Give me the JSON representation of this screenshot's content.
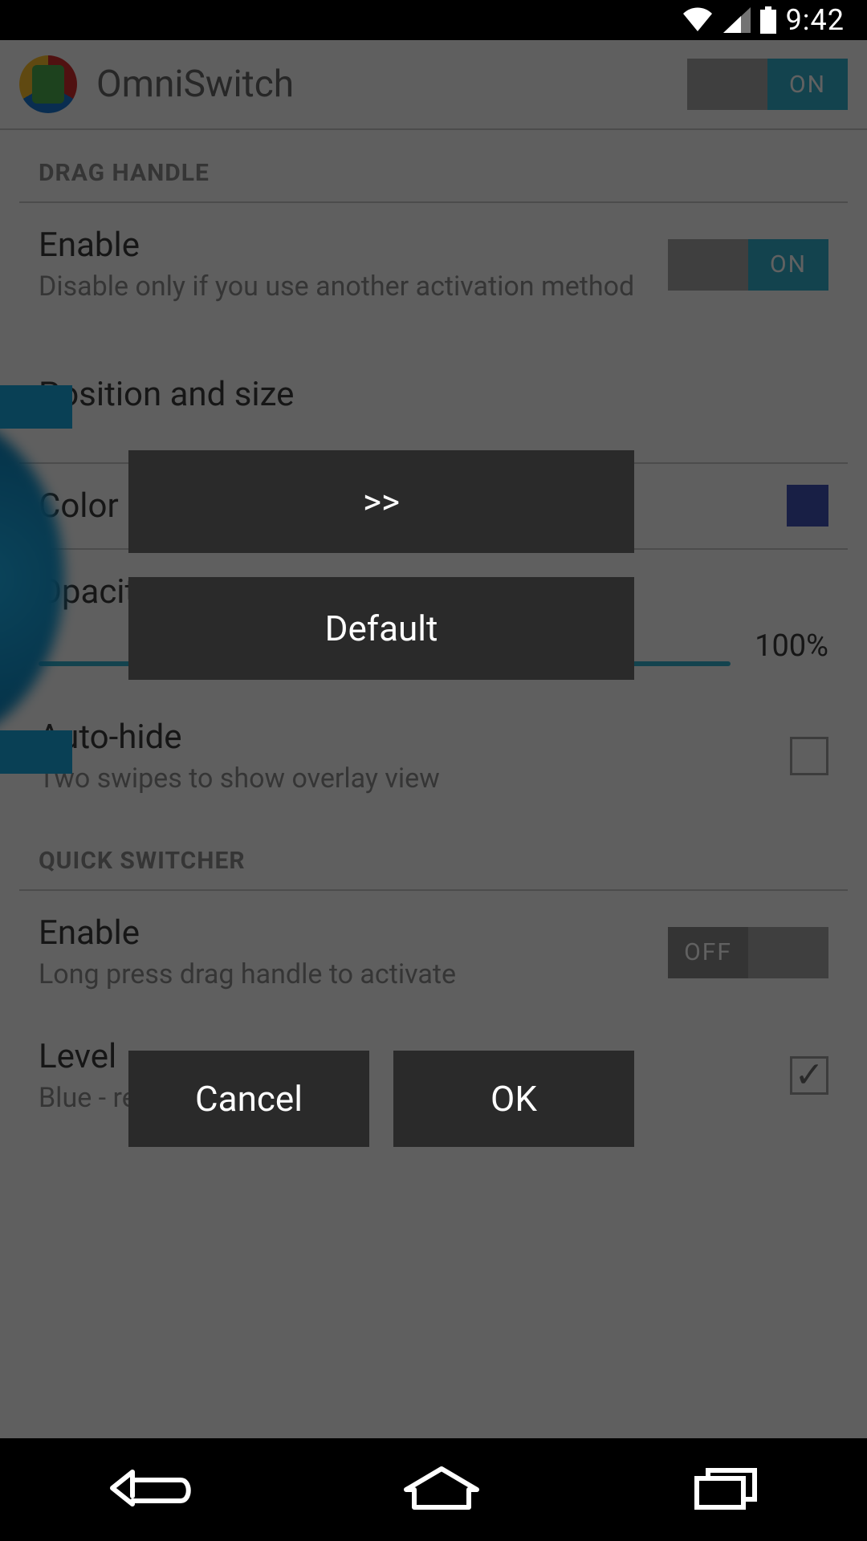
{
  "status": {
    "time": "9:42"
  },
  "header": {
    "app_name": "OmniSwitch",
    "toggle_label": "ON"
  },
  "sections": {
    "drag_handle": {
      "title": "DRAG HANDLE",
      "enable": {
        "title": "Enable",
        "sub": "Disable only if you use another activation method",
        "toggle_label": "ON"
      },
      "position": {
        "title": "Position and size"
      },
      "color": {
        "title": "Color"
      },
      "opacity": {
        "title": "Opacity",
        "value": "100%"
      },
      "autohide": {
        "title": "Auto-hide",
        "sub": "Two swipes to show overlay view"
      }
    },
    "quick_switcher": {
      "title": "QUICK SWITCHER",
      "enable": {
        "title": "Enable",
        "sub": "Long press drag handle to activate",
        "toggle_label": "OFF"
      },
      "level": {
        "title": "Level",
        "sub": "Blue - re"
      }
    }
  },
  "dialog": {
    "preview": ">>",
    "default_label": "Default",
    "cancel": "Cancel",
    "ok": "OK"
  }
}
